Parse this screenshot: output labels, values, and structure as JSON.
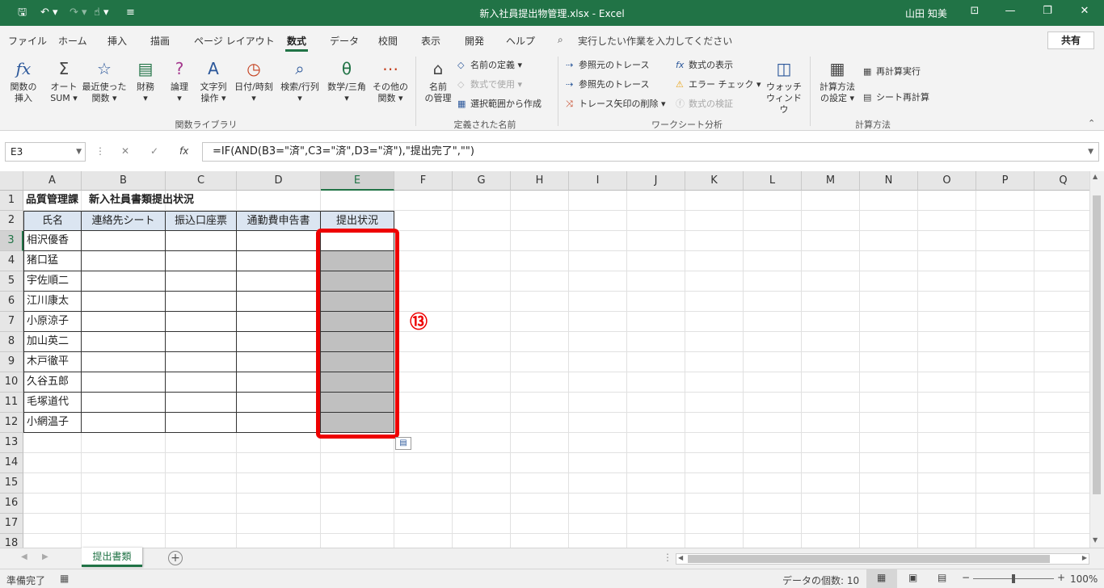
{
  "title_bar": {
    "title": "新入社員提出物管理.xlsx  -  Excel",
    "user": "山田 知美",
    "save_icon": "save-icon",
    "undo_icon": "undo-icon"
  },
  "ribbon_tabs": [
    "ファイル",
    "ホーム",
    "挿入",
    "描画",
    "ページ レイアウト",
    "数式",
    "データ",
    "校閲",
    "表示",
    "開発",
    "ヘルプ"
  ],
  "active_tab": "数式",
  "tell_me": "実行したい作業を入力してください",
  "share": "共有",
  "ribbon": {
    "library": {
      "buttons": [
        {
          "label1": "関数の",
          "label2": "挿入",
          "icon": "fx"
        },
        {
          "label1": "オート",
          "label2": "SUM ▾",
          "icon": "Σ"
        },
        {
          "label1": "最近使った",
          "label2": "関数 ▾",
          "icon": "☆"
        },
        {
          "label1": "財務",
          "label2": "▾",
          "icon": "▤"
        },
        {
          "label1": "論理",
          "label2": "▾",
          "icon": "?"
        },
        {
          "label1": "文字列",
          "label2": "操作 ▾",
          "icon": "A"
        },
        {
          "label1": "日付/時刻",
          "label2": "▾",
          "icon": "◷"
        },
        {
          "label1": "検索/行列",
          "label2": "▾",
          "icon": "⌕"
        },
        {
          "label1": "数学/三角",
          "label2": "▾",
          "icon": "θ"
        },
        {
          "label1": "その他の",
          "label2": "関数 ▾",
          "icon": "⋯"
        }
      ],
      "group": "関数ライブラリ"
    },
    "names": {
      "manager1": "名前",
      "manager2": "の管理",
      "define": "名前の定義",
      "use": "数式で使用",
      "create": "選択範囲から作成",
      "group": "定義された名前"
    },
    "audit": {
      "trace_prec": "参照元のトレース",
      "trace_dep": "参照先のトレース",
      "remove": "トレース矢印の削除",
      "show": "数式の表示",
      "error": "エラー チェック",
      "eval": "数式の検証",
      "watch1": "ウォッチ",
      "watch2": "ウィンドウ",
      "group": "ワークシート分析"
    },
    "calc": {
      "options1": "計算方法",
      "options2": "の設定 ▾",
      "now": "再計算実行",
      "sheet": "シート再計算",
      "group": "計算方法"
    }
  },
  "name_box": "E3",
  "formula": "=IF(AND(B3=\"済\",C3=\"済\",D3=\"済\"),\"提出完了\",\"\")",
  "columns": [
    "A",
    "B",
    "C",
    "D",
    "E",
    "F",
    "G",
    "H",
    "I",
    "J",
    "K",
    "L",
    "M",
    "N",
    "O",
    "P",
    "Q"
  ],
  "rows": [
    "1",
    "2",
    "3",
    "4",
    "5",
    "6",
    "7",
    "8",
    "9",
    "10",
    "11",
    "12",
    "13",
    "14",
    "15",
    "16",
    "17",
    "18"
  ],
  "sheet": {
    "title": "品質管理課　新入社員書類提出状況",
    "headers": [
      "氏名",
      "連絡先シート",
      "振込口座票",
      "通勤費申告書",
      "提出状況"
    ],
    "names": [
      "相沢優香",
      "猪口猛",
      "宇佐順二",
      "江川康太",
      "小原涼子",
      "加山英二",
      "木戸徹平",
      "久谷五郎",
      "毛塚道代",
      "小網温子"
    ]
  },
  "annotation": "⑬",
  "sheet_tab": "提出書類",
  "status": {
    "ready": "準備完了",
    "count": "データの個数: 10",
    "zoom": "100%",
    "zoom_level": 1.0
  }
}
